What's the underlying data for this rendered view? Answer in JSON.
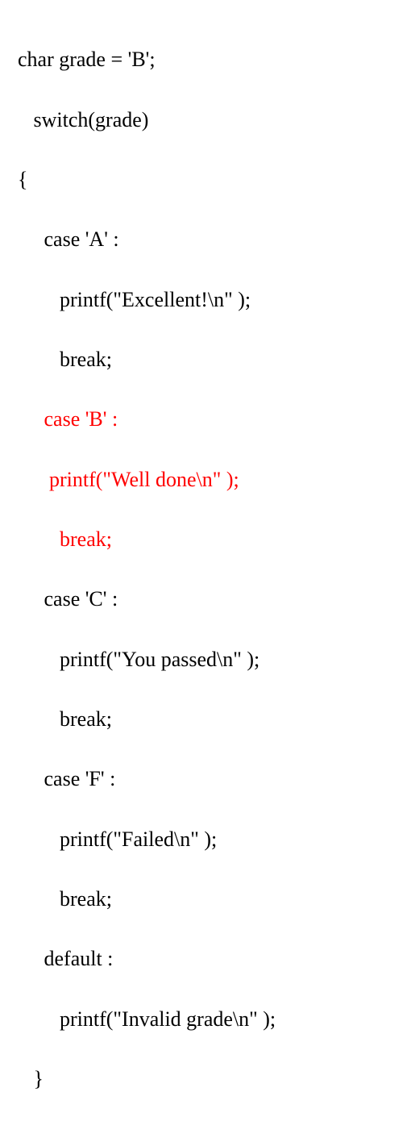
{
  "code": {
    "l1": "char grade = 'B';",
    "l2": "   switch(grade)",
    "l3": "{",
    "l4": "     case 'A' :",
    "l5": "        printf(\"Excellent!\\n\" );",
    "l6": "        break;",
    "l7": "     case 'B' :",
    "l8": "      printf(\"Well done\\n\" );",
    "l9": "        break;",
    "l10": "     case 'C' :",
    "l11": "        printf(\"You passed\\n\" );",
    "l12": "        break;",
    "l13": "     case 'F' :",
    "l14": "        printf(\"Failed\\n\" );",
    "l15": "        break;",
    "l16": "     default :",
    "l17": "        printf(\"Invalid grade\\n\" );",
    "l18": "   }"
  }
}
